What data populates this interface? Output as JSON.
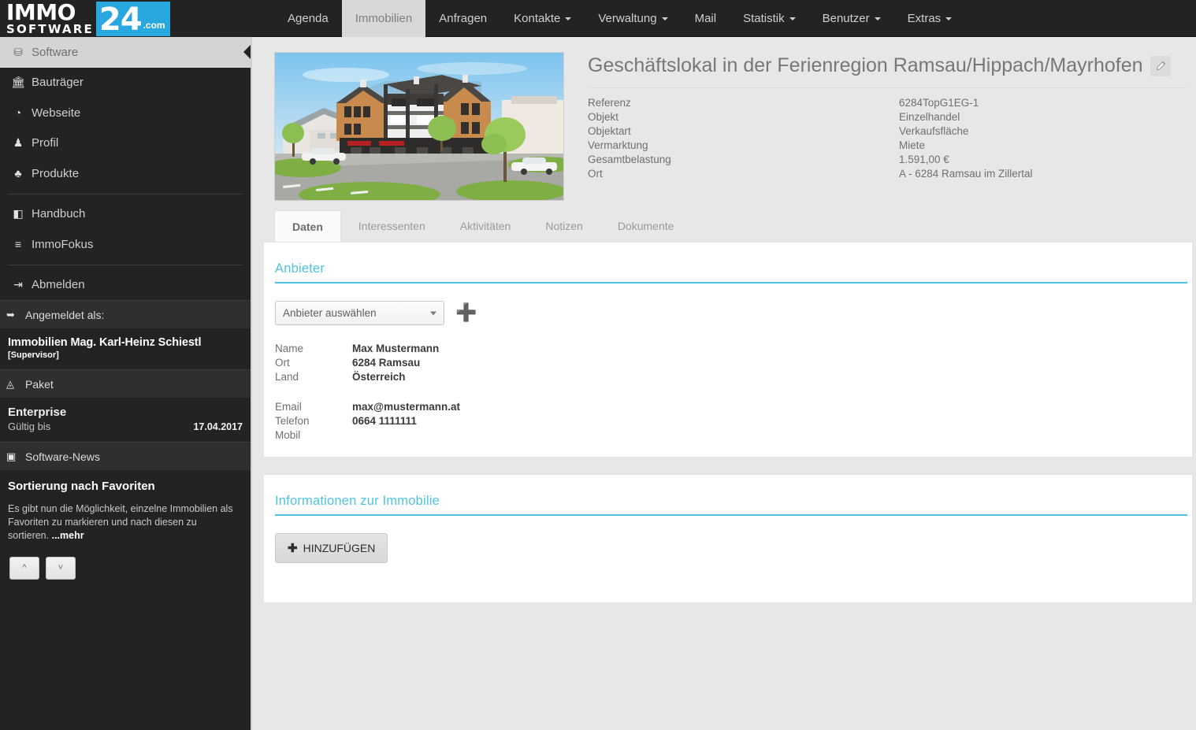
{
  "brand": {
    "line1": "IMMO",
    "line2": "SOFTWARE",
    "badge_number": "24",
    "badge_suffix": ".com",
    "accent": "#29a8df"
  },
  "topnav": {
    "items": [
      {
        "label": "Agenda",
        "active": false,
        "has_caret": false
      },
      {
        "label": "Immobilien",
        "active": true,
        "has_caret": false
      },
      {
        "label": "Anfragen",
        "active": false,
        "has_caret": false
      },
      {
        "label": "Kontakte",
        "active": false,
        "has_caret": true
      },
      {
        "label": "Verwaltung",
        "active": false,
        "has_caret": true
      },
      {
        "label": "Mail",
        "active": false,
        "has_caret": false
      },
      {
        "label": "Statistik",
        "active": false,
        "has_caret": true
      },
      {
        "label": "Benutzer",
        "active": false,
        "has_caret": true
      },
      {
        "label": "Extras",
        "active": false,
        "has_caret": true
      }
    ]
  },
  "sidebar": {
    "items": [
      {
        "label": "Software",
        "icon": "dashboard-icon",
        "glyph": "⛁",
        "active": true
      },
      {
        "label": "Bauträger",
        "icon": "bank-icon",
        "glyph": "🏛",
        "active": false
      },
      {
        "label": "Webseite",
        "icon": "globe-icon",
        "glyph": "◔",
        "active": false
      },
      {
        "label": "Profil",
        "icon": "user-icon",
        "glyph": "♟",
        "active": false
      },
      {
        "label": "Produkte",
        "icon": "cubes-icon",
        "glyph": "♣",
        "active": false
      },
      {
        "label": "Handbuch",
        "icon": "book-icon",
        "glyph": "◧",
        "active": false
      },
      {
        "label": "ImmoFokus",
        "icon": "list-icon",
        "glyph": "≡",
        "active": false
      },
      {
        "label": "Abmelden",
        "icon": "logout-icon",
        "glyph": "⇥",
        "active": false
      }
    ],
    "logged_in_header": "Angemeldet als:",
    "logged_in_icon": "signin-icon",
    "user_name": "Immobilien Mag. Karl-Heinz Schiestl",
    "user_role": "[Supervisor]",
    "package_header": "Paket",
    "package_icon": "package-icon",
    "package_name": "Enterprise",
    "package_valid_label": "Gültig bis",
    "package_valid_date": "17.04.2017",
    "news_header": "Software-News",
    "news_icon": "news-icon",
    "news_title": "Sortierung nach Favoriten",
    "news_text": "Es gibt nun die Möglichkeit, einzelne Immobilien als Favoriten zu markieren und nach diesen zu sortieren. ",
    "news_more": "...mehr",
    "news_prev_icon": "chevron-up-icon",
    "news_next_icon": "chevron-down-icon"
  },
  "property": {
    "title": "Geschäftslokal in der Ferienregion Ramsau/Hippach/Mayrhofen",
    "edit_icon": "pencil-icon",
    "image_alt": "property-rendering",
    "facts": [
      {
        "key": "Referenz",
        "value": "6284TopG1EG-1"
      },
      {
        "key": "Objekt",
        "value": "Einzelhandel"
      },
      {
        "key": "Objektart",
        "value": "Verkaufsfläche"
      },
      {
        "key": "Vermarktung",
        "value": "Miete"
      },
      {
        "key": "Gesamtbelastung",
        "value": "1.591,00 €"
      },
      {
        "key": "Ort",
        "value": "A - 6284 Ramsau im Zillertal"
      }
    ]
  },
  "tabs": [
    {
      "label": "Daten",
      "active": true
    },
    {
      "label": "Interessenten",
      "active": false
    },
    {
      "label": "Aktivitäten",
      "active": false
    },
    {
      "label": "Notizen",
      "active": false
    },
    {
      "label": "Dokumente",
      "active": false
    }
  ],
  "anbieter": {
    "section_title": "Anbieter",
    "select_value": "Anbieter auswählen",
    "add_icon": "plus-icon",
    "fields": [
      {
        "key": "Name",
        "value": "Max Mustermann"
      },
      {
        "key": "Ort",
        "value": "6284 Ramsau"
      },
      {
        "key": "Land",
        "value": "Österreich"
      }
    ],
    "contact": [
      {
        "key": "Email",
        "value": "max@mustermann.at"
      },
      {
        "key": "Telefon",
        "value": "0664 1111111"
      },
      {
        "key": "Mobil",
        "value": ""
      }
    ]
  },
  "info_section": {
    "section_title": "Informationen zur Immobilie",
    "add_button": "HINZUFÜGEN",
    "add_button_icon": "plus-icon"
  },
  "colors": {
    "accent_cyan": "#4ec3e0",
    "dark_chrome": "#232323",
    "page_bg": "#e7e7e7"
  }
}
